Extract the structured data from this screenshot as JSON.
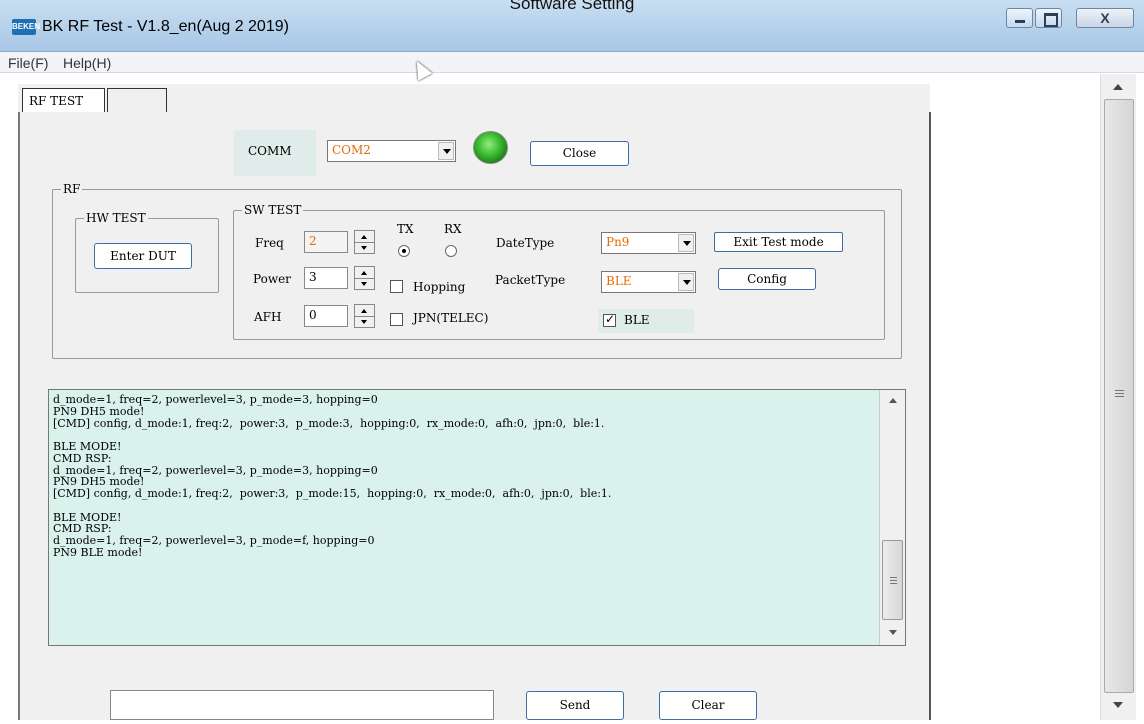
{
  "window": {
    "title": "BK RF Test - V1.8_en(Aug  2 2019)",
    "overlay_caption": "Software Setting",
    "icon_text": "BEKEN"
  },
  "titlebar_buttons": {
    "close_glyph": "X"
  },
  "menu": {
    "items": [
      "File(F)",
      "Help(H)"
    ]
  },
  "tabs": [
    "RF TEST",
    ""
  ],
  "comm": {
    "label": "COMM",
    "port_value": "COM2",
    "status": "connected",
    "status_color": "#37b62e",
    "button_label": "Close"
  },
  "rf_group": {
    "legend": "RF"
  },
  "hw_test": {
    "legend": "HW TEST",
    "enter_dut_label": "Enter DUT"
  },
  "sw_test": {
    "legend": "SW TEST",
    "freq": {
      "label": "Freq",
      "value": "2"
    },
    "power": {
      "label": "Power",
      "value": "3"
    },
    "afh": {
      "label": "AFH",
      "value": "0"
    },
    "tx_label": "TX",
    "rx_label": "RX",
    "tx_selected": true,
    "hopping": {
      "label": "Hopping",
      "checked": false
    },
    "jpn": {
      "label": "JPN(TELEC)",
      "checked": false
    },
    "datetype": {
      "label": "DateType",
      "value": "Pn9"
    },
    "packettype": {
      "label": "PacketType",
      "value": "BLE"
    },
    "ble": {
      "label": "BLE",
      "checked": true
    },
    "exit_test_label": "Exit Test mode",
    "config_label": "Config"
  },
  "log": {
    "lines": [
      "d_mode=1, freq=2, powerlevel=3, p_mode=3, hopping=0",
      "PN9 DH5 mode!",
      "[CMD] config, d_mode:1, freq:2,  power:3,  p_mode:3,  hopping:0,  rx_mode:0,  afh:0,  jpn:0,  ble:1.",
      "",
      "BLE MODE!",
      "CMD RSP:",
      "d_mode=1, freq=2, powerlevel=3, p_mode=3, hopping=0",
      "PN9 DH5 mode!",
      "[CMD] config, d_mode:1, freq:2,  power:3,  p_mode:15,  hopping:0,  rx_mode:0,  afh:0,  jpn:0,  ble:1.",
      "",
      "BLE MODE!",
      "CMD RSP:",
      "d_mode=1, freq=2, powerlevel=3, p_mode=f, hopping=0",
      "PN9 BLE mode!"
    ]
  },
  "bottom": {
    "send_input_value": "",
    "send_label": "Send",
    "clear_label": "Clear"
  },
  "colors": {
    "accent_value": "#e36c09",
    "log_bg": "#d9f2ec",
    "button_border": "#3a6ea5"
  }
}
